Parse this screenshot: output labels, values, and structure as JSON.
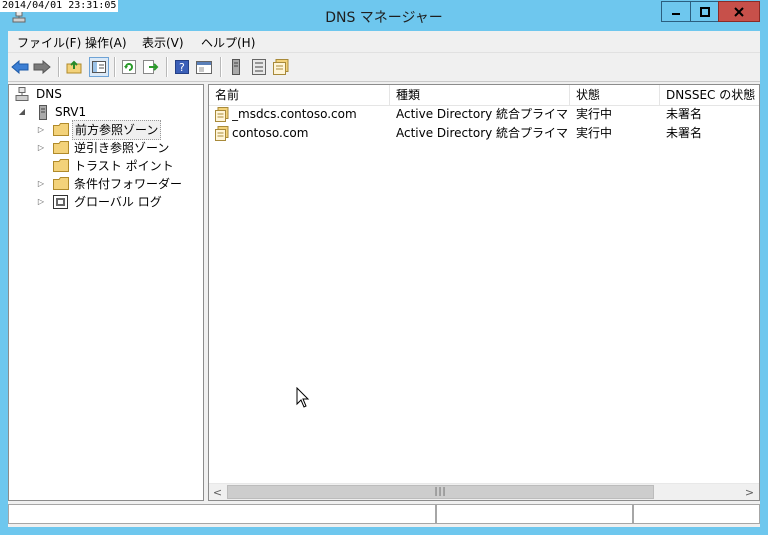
{
  "timestamp": "2014/04/01 23:31:05",
  "window": {
    "title": "DNS マネージャー",
    "controls": {
      "minimize": "minimize-icon",
      "maximize": "maximize-icon",
      "close": "close-icon"
    }
  },
  "menu": [
    "ファイル(F)",
    "操作(A)",
    "表示(V)",
    "ヘルプ(H)"
  ],
  "toolbar": [
    "back-icon",
    "forward-icon",
    "up-folder-icon",
    "show-hide-tree-icon",
    "refresh-icon",
    "export-list-icon",
    "help-icon",
    "console-icon",
    "server-icon",
    "list-view-icon",
    "properties-icon"
  ],
  "tree": {
    "root": "DNS",
    "server": "SRV1",
    "children": [
      "前方参照ゾーン",
      "逆引き参照ゾーン",
      "トラスト ポイント",
      "条件付フォワーダー",
      "グローバル ログ"
    ]
  },
  "list": {
    "columns": [
      "名前",
      "種類",
      "状態",
      "DNSSEC の状態"
    ],
    "rows": [
      {
        "name": "_msdcs.contoso.com",
        "type": "Active Directory 統合プライマリ",
        "status": "実行中",
        "dnssec": "未署名"
      },
      {
        "name": "contoso.com",
        "type": "Active Directory 統合プライマリ",
        "status": "実行中",
        "dnssec": "未署名"
      }
    ]
  },
  "colors": {
    "titlebar": "#6ec7ee",
    "close": "#c7504a",
    "folder": "#f3d27a"
  }
}
